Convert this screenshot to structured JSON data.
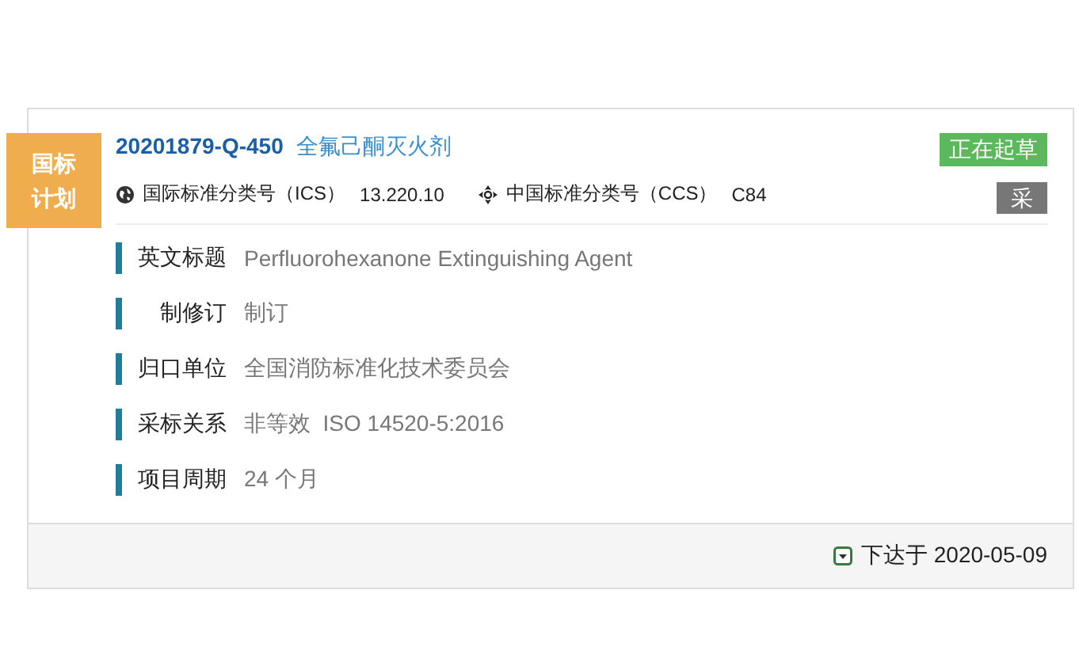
{
  "badge": "国标计划",
  "plan": {
    "number": "20201879-Q-450",
    "name": "全氟己酮灭火剂",
    "status": "正在起草",
    "tag": "采"
  },
  "classifications": [
    {
      "kind": "ics",
      "label": "国际标准分类号（ICS）",
      "value": "13.220.10"
    },
    {
      "kind": "ccs",
      "label": "中国标准分类号（CCS）",
      "value": "C84"
    }
  ],
  "details": [
    {
      "label": "英文标题",
      "value": "Perfluorohexanone Extinguishing Agent"
    },
    {
      "label": "制修订",
      "value": "制订"
    },
    {
      "label": "归口单位",
      "value": "全国消防标准化技术委员会"
    },
    {
      "label": "采标关系",
      "value": "非等效  ISO 14520-5:2016"
    },
    {
      "label": "项目周期",
      "value": "24 个月"
    }
  ],
  "footer": {
    "label": "下达于",
    "date": "2020-05-09"
  }
}
